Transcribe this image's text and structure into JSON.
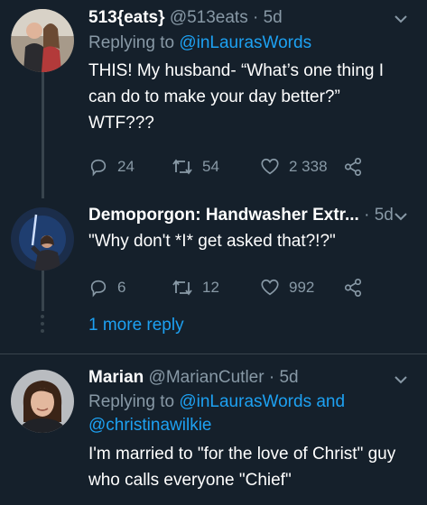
{
  "tweets": [
    {
      "name": "513{eats}",
      "handle": "@513eats",
      "dot": "·",
      "time": "5d",
      "replying_prefix": "Replying to ",
      "replying_to": "@inLaurasWords",
      "text_lines": [
        "THIS! My husband- “What’s one thing I",
        "can do to make your day better?”",
        "WTF???"
      ],
      "stats": {
        "replies": "24",
        "retweets": "54",
        "likes": "2 338"
      }
    },
    {
      "name": "Demoporgon: Handwasher Extr...",
      "dot": "·",
      "time": "5d",
      "text_lines": [
        "\"Why don't *I* get asked that?!?\""
      ],
      "stats": {
        "replies": "6",
        "retweets": "12",
        "likes": "992"
      }
    },
    {
      "name": "Marian",
      "handle": "@MarianCutler",
      "dot": "·",
      "time": "5d",
      "replying_prefix": "Replying to ",
      "replying_to": "@inLaurasWords",
      "replying_and": " and",
      "replying_to_2": "@christinawilkie",
      "text_lines": [
        "I'm married to \"for the love of Christ\" guy",
        "who calls everyone \"Chief\""
      ]
    }
  ],
  "more_replies": "1 more reply",
  "colors": {
    "background": "#15202b",
    "text": "#ffffff",
    "secondary": "#8899a6",
    "link": "#1da1f2",
    "line": "#38444d"
  },
  "icons": [
    "reply-icon",
    "retweet-icon",
    "like-icon",
    "share-icon",
    "chevron-down-icon"
  ]
}
